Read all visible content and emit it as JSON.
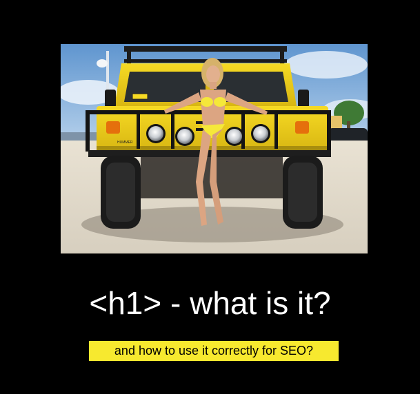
{
  "poster": {
    "headline": "<h1> - what is it?",
    "subtitle": "and how to use it correctly for SEO?"
  },
  "photo": {
    "vehicle_badge": "HUMMER"
  },
  "colors": {
    "background": "#000000",
    "headline_text": "#ffffff",
    "subtitle_highlight": "#f7e92f",
    "vehicle_yellow": "#f1d21c"
  }
}
